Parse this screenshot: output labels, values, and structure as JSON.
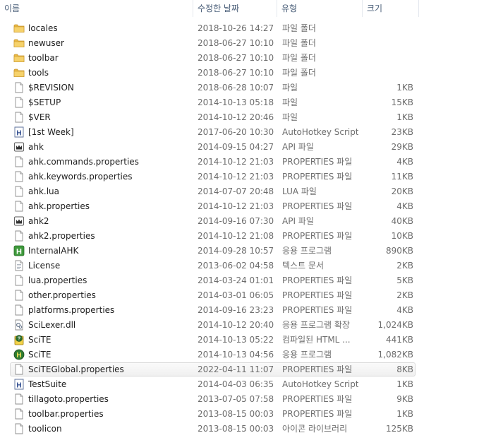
{
  "header": {
    "name": "이름",
    "date": "수정한 날짜",
    "type": "유형",
    "size": "크기",
    "sort_indicator": "^"
  },
  "files": [
    {
      "name": "locales",
      "date": "2018-10-26 14:27",
      "type": "파일 폴더",
      "size": "",
      "icon": "folder-icon"
    },
    {
      "name": "newuser",
      "date": "2018-06-27 10:10",
      "type": "파일 폴더",
      "size": "",
      "icon": "folder-icon"
    },
    {
      "name": "toolbar",
      "date": "2018-06-27 10:10",
      "type": "파일 폴더",
      "size": "",
      "icon": "folder-icon"
    },
    {
      "name": "tools",
      "date": "2018-06-27 10:10",
      "type": "파일 폴더",
      "size": "",
      "icon": "folder-icon"
    },
    {
      "name": "$REVISION",
      "date": "2018-06-28 10:07",
      "type": "파일",
      "size": "1KB",
      "icon": "file-icon"
    },
    {
      "name": "$SETUP",
      "date": "2014-10-13 05:18",
      "type": "파일",
      "size": "15KB",
      "icon": "file-icon"
    },
    {
      "name": "$VER",
      "date": "2014-10-12 20:46",
      "type": "파일",
      "size": "1KB",
      "icon": "file-icon"
    },
    {
      "name": "[1st Week]",
      "date": "2017-06-20 10:30",
      "type": "AutoHotkey Script",
      "size": "23KB",
      "icon": "ahk-script-icon"
    },
    {
      "name": "ahk",
      "date": "2014-09-15 04:27",
      "type": "API 파일",
      "size": "29KB",
      "icon": "api-file-icon"
    },
    {
      "name": "ahk.commands.properties",
      "date": "2014-10-12 21:03",
      "type": "PROPERTIES 파일",
      "size": "4KB",
      "icon": "file-icon"
    },
    {
      "name": "ahk.keywords.properties",
      "date": "2014-10-12 21:03",
      "type": "PROPERTIES 파일",
      "size": "11KB",
      "icon": "file-icon"
    },
    {
      "name": "ahk.lua",
      "date": "2014-07-07 20:48",
      "type": "LUA 파일",
      "size": "20KB",
      "icon": "file-icon"
    },
    {
      "name": "ahk.properties",
      "date": "2014-10-12 21:03",
      "type": "PROPERTIES 파일",
      "size": "4KB",
      "icon": "file-icon"
    },
    {
      "name": "ahk2",
      "date": "2014-09-16 07:30",
      "type": "API 파일",
      "size": "40KB",
      "icon": "api-file-icon"
    },
    {
      "name": "ahk2.properties",
      "date": "2014-10-12 21:08",
      "type": "PROPERTIES 파일",
      "size": "10KB",
      "icon": "file-icon"
    },
    {
      "name": "InternalAHK",
      "date": "2014-09-28 10:57",
      "type": "응용 프로그램",
      "size": "890KB",
      "icon": "ahk-exe-icon"
    },
    {
      "name": "License",
      "date": "2013-06-02 04:58",
      "type": "텍스트 문서",
      "size": "2KB",
      "icon": "text-document-icon"
    },
    {
      "name": "lua.properties",
      "date": "2014-03-24 01:01",
      "type": "PROPERTIES 파일",
      "size": "5KB",
      "icon": "file-icon"
    },
    {
      "name": "other.properties",
      "date": "2014-03-01 06:05",
      "type": "PROPERTIES 파일",
      "size": "2KB",
      "icon": "file-icon"
    },
    {
      "name": "platforms.properties",
      "date": "2014-09-16 23:23",
      "type": "PROPERTIES 파일",
      "size": "4KB",
      "icon": "file-icon"
    },
    {
      "name": "SciLexer.dll",
      "date": "2014-10-12 20:40",
      "type": "응용 프로그램 확장",
      "size": "1,024KB",
      "icon": "dll-icon"
    },
    {
      "name": "SciTE",
      "date": "2014-10-13 05:22",
      "type": "컴파일된 HTML ...",
      "size": "441KB",
      "icon": "chm-help-icon"
    },
    {
      "name": "SciTE",
      "date": "2014-10-13 04:56",
      "type": "응용 프로그램",
      "size": "1,082KB",
      "icon": "scite-exe-icon"
    },
    {
      "name": "SciTEGlobal.properties",
      "date": "2022-04-11 11:07",
      "type": "PROPERTIES 파일",
      "size": "8KB",
      "icon": "file-icon",
      "selected": true
    },
    {
      "name": "TestSuite",
      "date": "2014-04-03 06:35",
      "type": "AutoHotkey Script",
      "size": "1KB",
      "icon": "ahk-script-icon"
    },
    {
      "name": "tillagoto.properties",
      "date": "2013-07-05 07:58",
      "type": "PROPERTIES 파일",
      "size": "9KB",
      "icon": "file-icon"
    },
    {
      "name": "toolbar.properties",
      "date": "2013-08-15 00:03",
      "type": "PROPERTIES 파일",
      "size": "1KB",
      "icon": "file-icon"
    },
    {
      "name": "toolicon",
      "date": "2013-08-15 00:03",
      "type": "아이콘 라이브러리",
      "size": "125KB",
      "icon": "file-icon"
    }
  ]
}
